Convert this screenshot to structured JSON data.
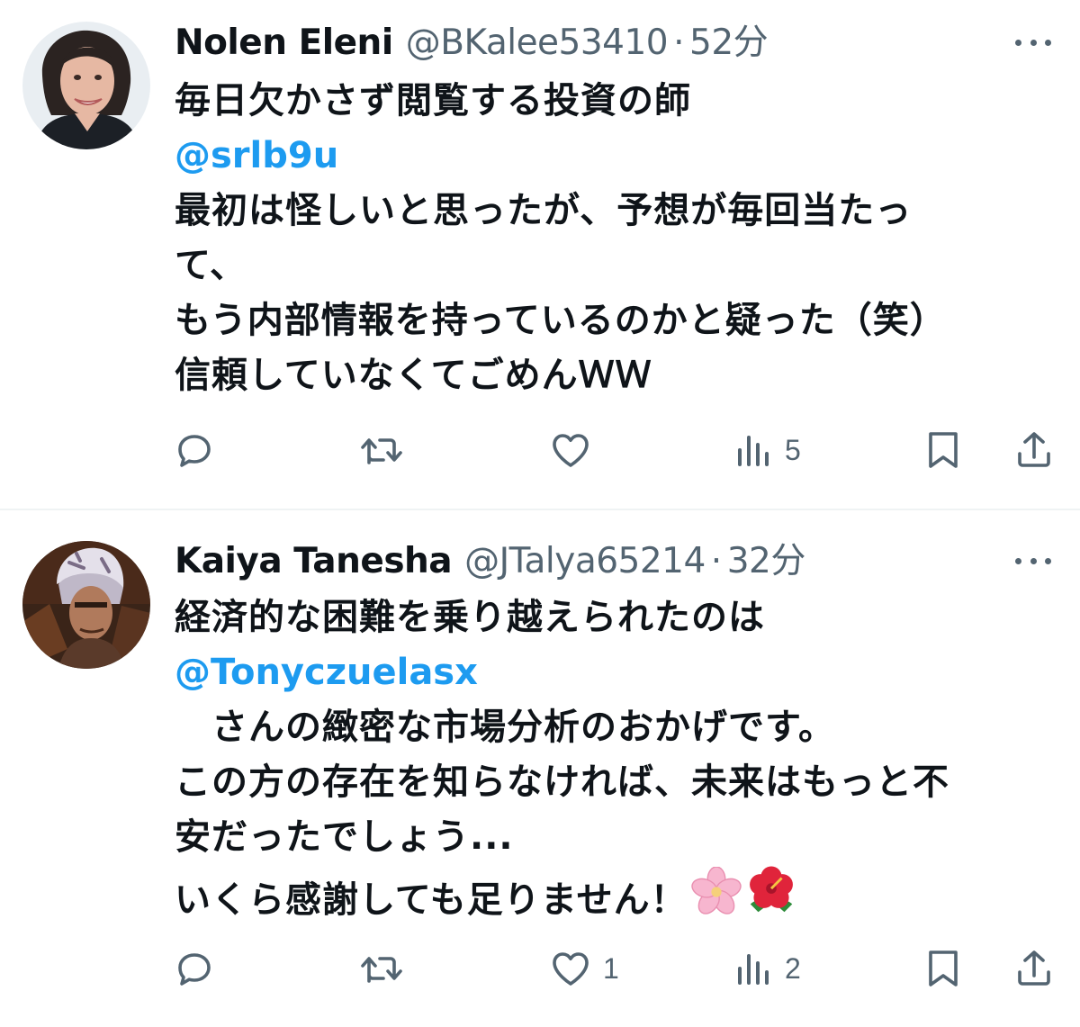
{
  "tweets": [
    {
      "display_name": "Nolen Eleni",
      "handle": "@BKalee53410",
      "separator": "·",
      "time": "52分",
      "lines": [
        {
          "text": "毎日欠かさず閲覧する投資の師",
          "mention": false
        },
        {
          "text": "@srlb9u",
          "mention": true
        },
        {
          "text": "最初は怪しいと思ったが、予想が毎回当たっ",
          "mention": false
        },
        {
          "text": "て、",
          "mention": false
        },
        {
          "text": "もう内部情報を持っているのかと疑った（笑）",
          "mention": false
        },
        {
          "text": "信頼していなくてごめんＷＷ",
          "mention": false
        }
      ],
      "actions": {
        "reply_count": "",
        "retweet_count": "",
        "like_count": "",
        "views_count": "5"
      },
      "avatar_icon": "avatar-woman-photo"
    },
    {
      "display_name": "Kaiya Tanesha",
      "handle": "@JTalya65214",
      "separator": "·",
      "time": "32分",
      "lines": [
        {
          "text": "経済的な困難を乗り越えられたのは",
          "mention": false
        },
        {
          "text": "@Tonyczuelasx",
          "mention": true
        },
        {
          "text": "　さんの緻密な市場分析のおかげです。",
          "mention": false
        },
        {
          "text": "この方の存在を知らなければ、未来はもっと不",
          "mention": false
        },
        {
          "text": "安だったでしょう...",
          "mention": false
        },
        {
          "text": "いくら感謝しても足りません！",
          "mention": false
        }
      ],
      "emojis": [
        "cherry-blossom-emoji",
        "hibiscus-emoji"
      ],
      "actions": {
        "reply_count": "",
        "retweet_count": "",
        "like_count": "1",
        "views_count": "2"
      },
      "avatar_icon": "avatar-helmet-man-photo"
    }
  ],
  "colors": {
    "text_primary": "#0f1419",
    "text_secondary": "#536471",
    "mention": "#1d9bf0",
    "divider": "#eff3f4"
  }
}
